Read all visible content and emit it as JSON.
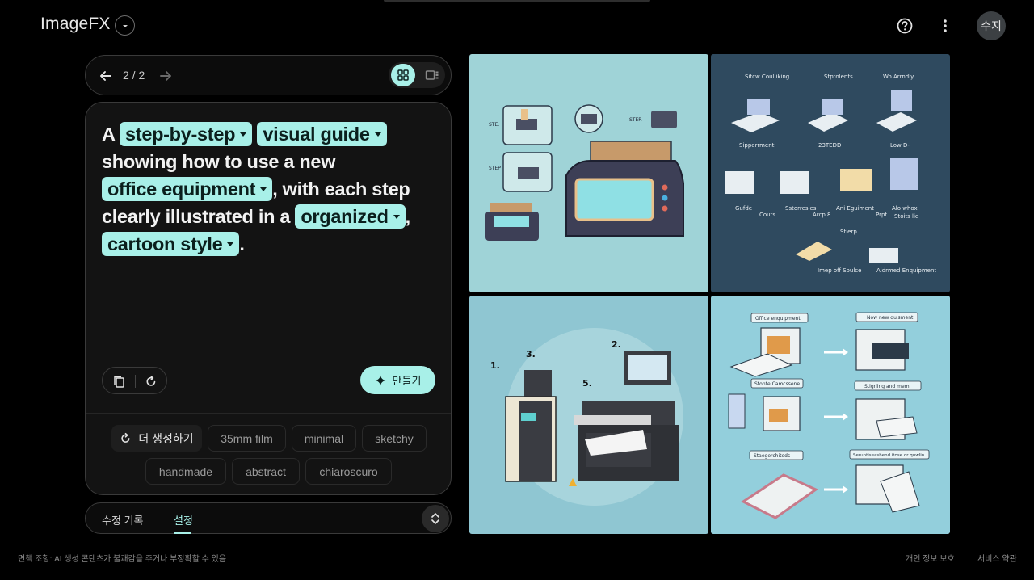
{
  "app": {
    "title": "ImageFX"
  },
  "header": {
    "avatar_label": "수지"
  },
  "nav": {
    "counter": "2 / 2"
  },
  "prompt": {
    "parts": [
      {
        "t": "A "
      },
      {
        "chip": "step-by-step"
      },
      {
        "t": " "
      },
      {
        "chip": "visual guide"
      },
      {
        "t": " showing how to use a new "
      },
      {
        "chip": "office equipment"
      },
      {
        "t": ", with each step clearly illustrated in a "
      },
      {
        "chip": "organized"
      },
      {
        "t": ", "
      },
      {
        "chip": "cartoon style"
      },
      {
        "t": "."
      }
    ]
  },
  "actions": {
    "make_label": "만들기"
  },
  "suggestions": {
    "more_label": "더 생성하기",
    "items": [
      "35mm film",
      "minimal",
      "sketchy",
      "handmade",
      "abstract",
      "chiaroscuro"
    ]
  },
  "tabs": {
    "history": "수정 기록",
    "settings": "설정"
  },
  "images": {
    "img1": {
      "labels": [
        "STE.",
        "STEP.",
        "STEP"
      ]
    },
    "img2": {
      "labels": [
        "Sitcw Coulliking",
        "Stptolents",
        "Wo Arrndly",
        "Sipperrment",
        "23TEDD",
        "Low D-",
        "Gufde",
        "Couts",
        "Sstorresles",
        "Arcp 8",
        "Ani Eguiment",
        "Prpt",
        "Alo whox",
        "Stoits lie",
        "Stierp",
        "Imep off Soulce",
        "Aidrmed Enquipment"
      ]
    },
    "img3": {
      "labels": [
        "1.",
        "3.",
        "2.",
        "5."
      ]
    },
    "img4": {
      "labels": [
        "Office enquipment",
        "Now new quisment",
        "Stonte Camcssene",
        "Stigrling and mem",
        "Staegerchiteds",
        "Seruntiseashend itose or quwlin"
      ]
    }
  },
  "footer": {
    "disclaimer": "면책 조항: AI 생성 콘텐츠가 불쾌감을 주거나 부정확할 수 있음",
    "privacy": "개인 정보 보호",
    "terms": "서비스 약관"
  }
}
